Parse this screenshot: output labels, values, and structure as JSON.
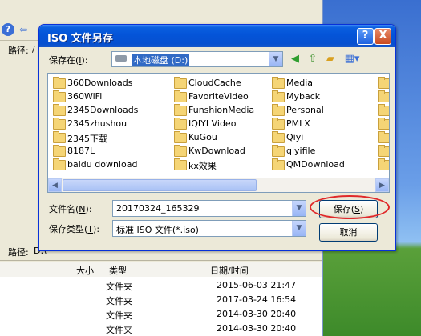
{
  "background_app": {
    "path_label": "路径:",
    "path_value_top": "/",
    "path_value_bottom": "D:\\",
    "columns": [
      "大小",
      "类型",
      "日期/时间"
    ],
    "rows": [
      {
        "type": "文件夹",
        "date": "2015-06-03 21:47"
      },
      {
        "type": "文件夹",
        "date": "2017-03-24 16:54"
      },
      {
        "type": "文件夹",
        "date": "2014-03-30 20:40"
      },
      {
        "type": "文件夹",
        "date": "2014-03-30 20:40"
      }
    ]
  },
  "dialog": {
    "title": "ISO 文件另存",
    "help_button": "?",
    "close_button": "X",
    "save_in_label": "保存在(",
    "save_in_key": "I",
    "save_in_suffix": "):",
    "save_in_value": "本地磁盘 (D:)",
    "folders": [
      [
        "360Downloads",
        "CloudCache",
        "Media"
      ],
      [
        "360WiFi",
        "FavoriteVideo",
        "Myback"
      ],
      [
        "2345Downloads",
        "FunshionMedia",
        "Personal"
      ],
      [
        "2345zhushou",
        "IQIYI Video",
        "PMLX"
      ],
      [
        "2345下载",
        "KuGou",
        "Qiyi"
      ],
      [
        "8187L",
        "KwDownload",
        "qiyifile"
      ],
      [
        "baidu download",
        "kx效果",
        "QMDownload"
      ]
    ],
    "filename_label": "文件名(",
    "filename_key": "N",
    "filename_suffix": "):",
    "filename_value": "20170324_165329",
    "filetype_label": "保存类型(",
    "filetype_key": "T",
    "filetype_suffix": "):",
    "filetype_value": "标准 ISO 文件(*.iso)",
    "save_button": "保存(",
    "save_key": "S",
    "save_suffix": ")",
    "cancel_button": "取消"
  },
  "colors": {
    "titlebar": "#0454d8",
    "highlight": "#316ac5",
    "annotation_ring": "#e0292a"
  }
}
